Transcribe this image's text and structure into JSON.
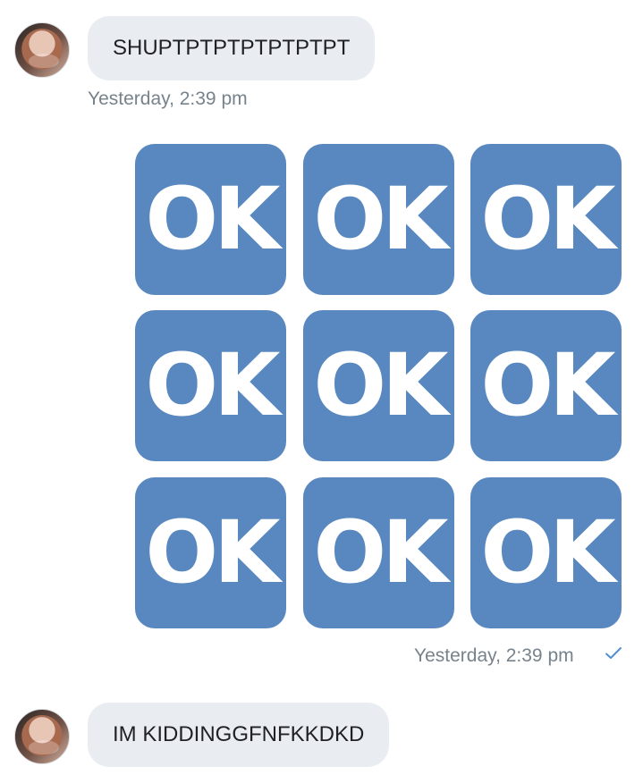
{
  "messages": {
    "incoming_1": {
      "text": "SHUPTPTPTPTPTPTPT",
      "timestamp": "Yesterday, 2:39 pm"
    },
    "sticker_message": {
      "tiles": [
        "OK",
        "OK",
        "OK",
        "OK",
        "OK",
        "OK",
        "OK",
        "OK",
        "OK"
      ],
      "timestamp": "Yesterday, 2:39 pm",
      "status_icon": "checkmark-icon"
    },
    "incoming_2": {
      "text": "IM KIDDINGGFNFKKDKD"
    }
  },
  "colors": {
    "incoming_bubble": "#e9edf1",
    "sticker_blue": "#5888bf",
    "timestamp": "#77838c",
    "checkmark": "#4f8fd6"
  },
  "icons": {
    "avatar": "user-avatar",
    "read_status": "checkmark-icon"
  }
}
